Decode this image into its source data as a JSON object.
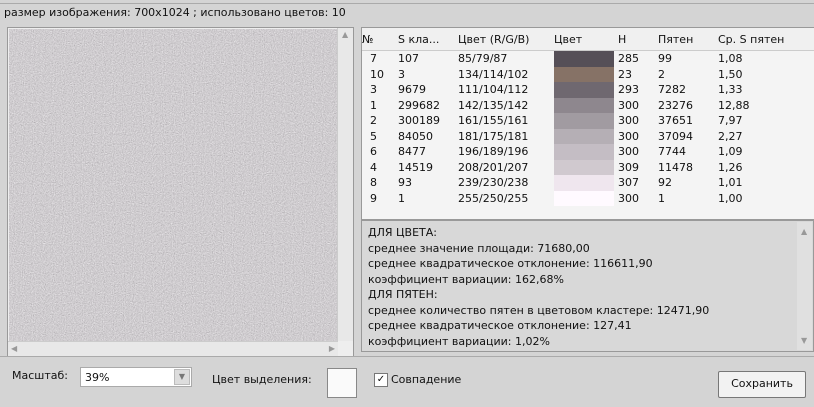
{
  "status": "размер изображения: 700x1024 ; использовано цветов: 10",
  "table": {
    "headers": [
      "№",
      "S кла...",
      "Цвет (R/G/B)",
      "Цвет",
      "H",
      "Пятен",
      "Ср. S пятен"
    ],
    "rows": [
      {
        "n": "7",
        "s": "107",
        "rgb": "85/79/87",
        "color": "#554f57",
        "h": "285",
        "spots": "99",
        "avg": "1,08"
      },
      {
        "n": "10",
        "s": "3",
        "rgb": "134/114/102",
        "color": "#867266",
        "h": "23",
        "spots": "2",
        "avg": "1,50"
      },
      {
        "n": "3",
        "s": "9679",
        "rgb": "111/104/112",
        "color": "#6f6870",
        "h": "293",
        "spots": "7282",
        "avg": "1,33"
      },
      {
        "n": "1",
        "s": "299682",
        "rgb": "142/135/142",
        "color": "#8e878e",
        "h": "300",
        "spots": "23276",
        "avg": "12,88"
      },
      {
        "n": "2",
        "s": "300189",
        "rgb": "161/155/161",
        "color": "#a19ba1",
        "h": "300",
        "spots": "37651",
        "avg": "7,97"
      },
      {
        "n": "5",
        "s": "84050",
        "rgb": "181/175/181",
        "color": "#b5afb5",
        "h": "300",
        "spots": "37094",
        "avg": "2,27"
      },
      {
        "n": "6",
        "s": "8477",
        "rgb": "196/189/196",
        "color": "#c4bdc4",
        "h": "300",
        "spots": "7744",
        "avg": "1,09"
      },
      {
        "n": "4",
        "s": "14519",
        "rgb": "208/201/207",
        "color": "#d0c9cf",
        "h": "309",
        "spots": "11478",
        "avg": "1,26"
      },
      {
        "n": "8",
        "s": "93",
        "rgb": "239/230/238",
        "color": "#efe6ee",
        "h": "307",
        "spots": "92",
        "avg": "1,01"
      },
      {
        "n": "9",
        "s": "1",
        "rgb": "255/250/255",
        "color": "#fffaff",
        "h": "300",
        "spots": "1",
        "avg": "1,00"
      }
    ]
  },
  "stats": [
    "ДЛЯ ЦВЕТА:",
    "среднее значение площади: 71680,00",
    "среднее квадратическое отклонение: 116611,90",
    "коэффициент вариации: 162,68%",
    "ДЛЯ ПЯТЕН:",
    "среднее количество пятен в цветовом кластере: 12471,90",
    "среднее квадратическое отклонение: 127,41",
    "коэффициент вариации: 1,02%"
  ],
  "bottom": {
    "scale_label": "Масштаб:",
    "scale_value": "39%",
    "highlight_label": "Цвет выделения:",
    "match_label": "Совпадение",
    "match_checked": true,
    "save_label": "Сохранить"
  }
}
